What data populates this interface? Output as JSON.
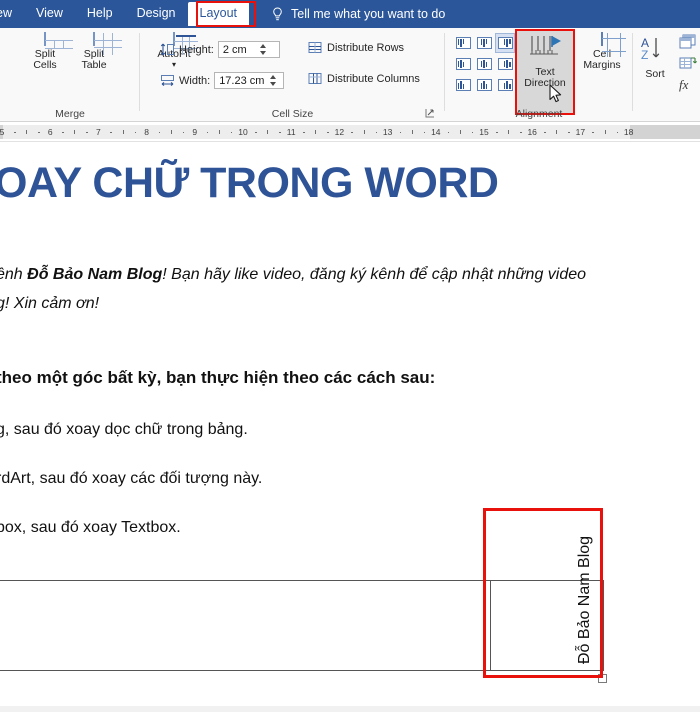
{
  "colors": {
    "ribbon_blue": "#2b579a",
    "highlight_red": "#e8110b",
    "title_blue": "#2e5396",
    "icon_blue": "#5b7fb5"
  },
  "tabbar": {
    "tabs": [
      {
        "label": "ew",
        "active": false,
        "clipped": true
      },
      {
        "label": "View",
        "active": false
      },
      {
        "label": "Help",
        "active": false
      },
      {
        "label": "Design",
        "active": false
      },
      {
        "label": "Layout",
        "active": true
      }
    ],
    "tellme": {
      "icon": "lightbulb-icon",
      "label": "Tell me what you want to do"
    }
  },
  "ribbon": {
    "groups": [
      {
        "name": "merge",
        "label": "Merge"
      },
      {
        "name": "cell-size",
        "label": "Cell Size"
      },
      {
        "name": "alignment",
        "label": "Alignment"
      },
      {
        "name": "data",
        "label": ""
      }
    ],
    "merge": {
      "split_cells": "Split\nCells",
      "split_cells_l1": "Split",
      "split_cells_l2": "Cells",
      "split_table_l1": "Split",
      "split_table_l2": "Table"
    },
    "cell_size": {
      "autofit_label": "AutoFit",
      "height_label": "Height:",
      "height_value": "2 cm",
      "width_label": "Width:",
      "width_value": "17.23 cm",
      "distribute_rows": "Distribute Rows",
      "distribute_columns": "Distribute Columns",
      "launcher": "dialog-box-launcher"
    },
    "alignment": {
      "grid_selected_index": 2,
      "text_direction_l1": "Text",
      "text_direction_l2": "Direction",
      "cell_margins_l1": "Cell",
      "cell_margins_l2": "Margins"
    },
    "data": {
      "sort_l1": "Sort",
      "repeat_header_rows": "repeat-header-rows-icon",
      "convert_to_text": "convert-to-text-icon",
      "formula": "fx"
    }
  },
  "ruler": {
    "numbers": [
      "5",
      "6",
      "7",
      "8",
      "9",
      "10",
      "11",
      "12",
      "13",
      "14",
      "15",
      "16",
      "17",
      "18"
    ]
  },
  "document": {
    "title": "OAY CHỮ TRONG WORD",
    "paragraphs": [
      {
        "id": "intro-line-1",
        "prefix": "ênh ",
        "bold": "Đỗ Bảo Nam Blog",
        "suffix": "! Bạn hãy like video, đăng ký kênh để cập nhật những video"
      },
      {
        "id": "intro-line-2",
        "text": "g! Xin cảm ơn!"
      },
      {
        "id": "lead-line",
        "text": "theo một góc bất kỳ, bạn thực hiện theo các cách sau:"
      },
      {
        "id": "method-1",
        "text": "g, sau đó xoay dọc chữ trong bảng."
      },
      {
        "id": "method-2",
        "text": "rdArt, sau đó xoay các đối tượng này."
      },
      {
        "id": "method-3",
        "text": "box, sau đó xoay Textbox."
      }
    ],
    "table": {
      "vertical_cell_text": "Đỗ Bảo Nam Blog",
      "vertical_cell_lines": [
        "Đỗ Bảo",
        "Nam",
        "Blog"
      ]
    }
  }
}
